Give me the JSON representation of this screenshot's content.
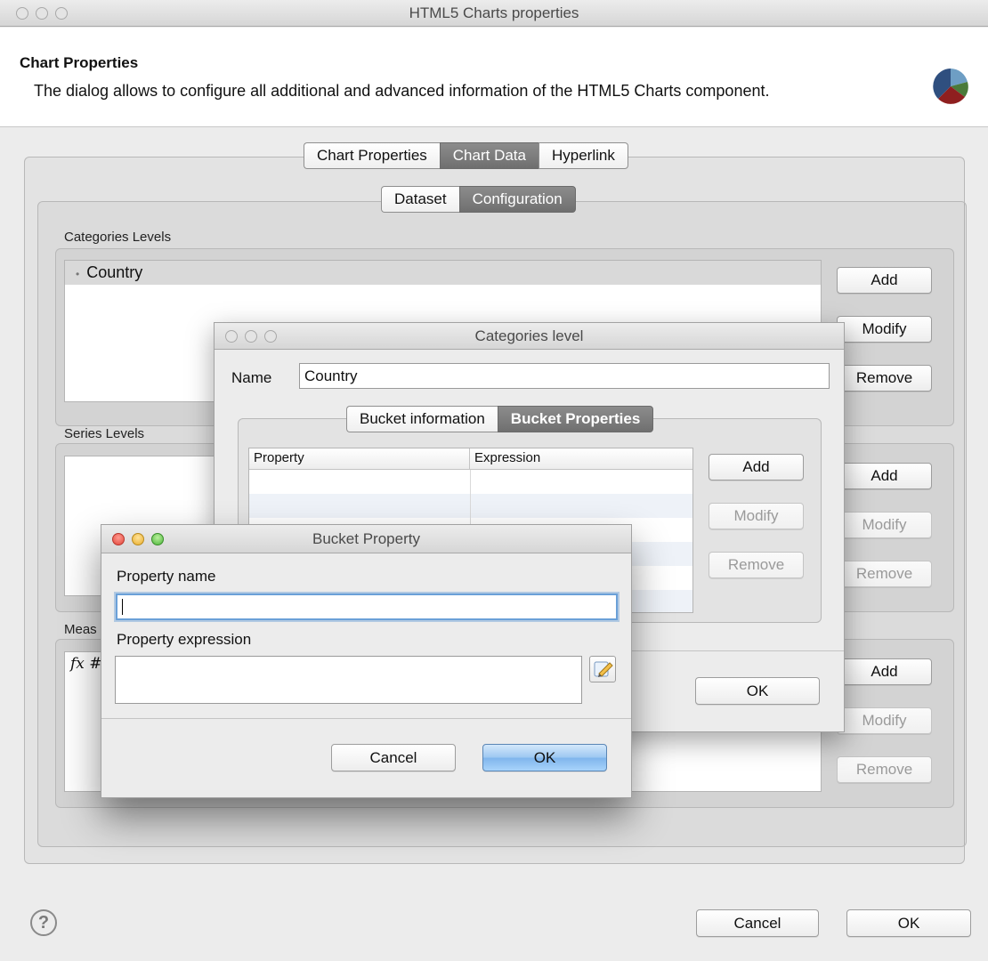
{
  "main_window": {
    "title": "HTML5 Charts properties",
    "header_title": "Chart Properties",
    "header_description": "The dialog allows to configure all additional and advanced information of the HTML5 Charts component.",
    "tabs": [
      "Chart Properties",
      "Chart Data",
      "Hyperlink"
    ],
    "selected_tab": "Chart Data",
    "sub_tabs": [
      "Dataset",
      "Configuration"
    ],
    "selected_sub_tab": "Configuration",
    "categories_label": "Categories Levels",
    "categories_items": [
      "Country"
    ],
    "series_label": "Series Levels",
    "measures_label_partial": "Meas",
    "measures_item_partial": "fx #",
    "side_buttons": {
      "add": "Add",
      "modify": "Modify",
      "remove": "Remove"
    },
    "cancel": "Cancel",
    "ok": "OK",
    "help": "?"
  },
  "categories_dialog": {
    "title": "Categories level",
    "name_label": "Name",
    "name_value": "Country",
    "tabs": [
      "Bucket information",
      "Bucket Properties"
    ],
    "selected_tab": "Bucket Properties",
    "table_headers": [
      "Property",
      "Expression"
    ],
    "buttons": {
      "add": "Add",
      "modify": "Modify",
      "remove": "Remove"
    },
    "ok": "OK"
  },
  "bucket_dialog": {
    "title": "Bucket Property",
    "property_name_label": "Property name",
    "property_name_value": "",
    "property_expression_label": "Property expression",
    "property_expression_value": "",
    "cancel": "Cancel",
    "ok": "OK"
  },
  "colors": {
    "selected_tab": "#7a7a7a",
    "primary_button": "#8fbff0",
    "focus_ring": "#6aa0d8"
  }
}
